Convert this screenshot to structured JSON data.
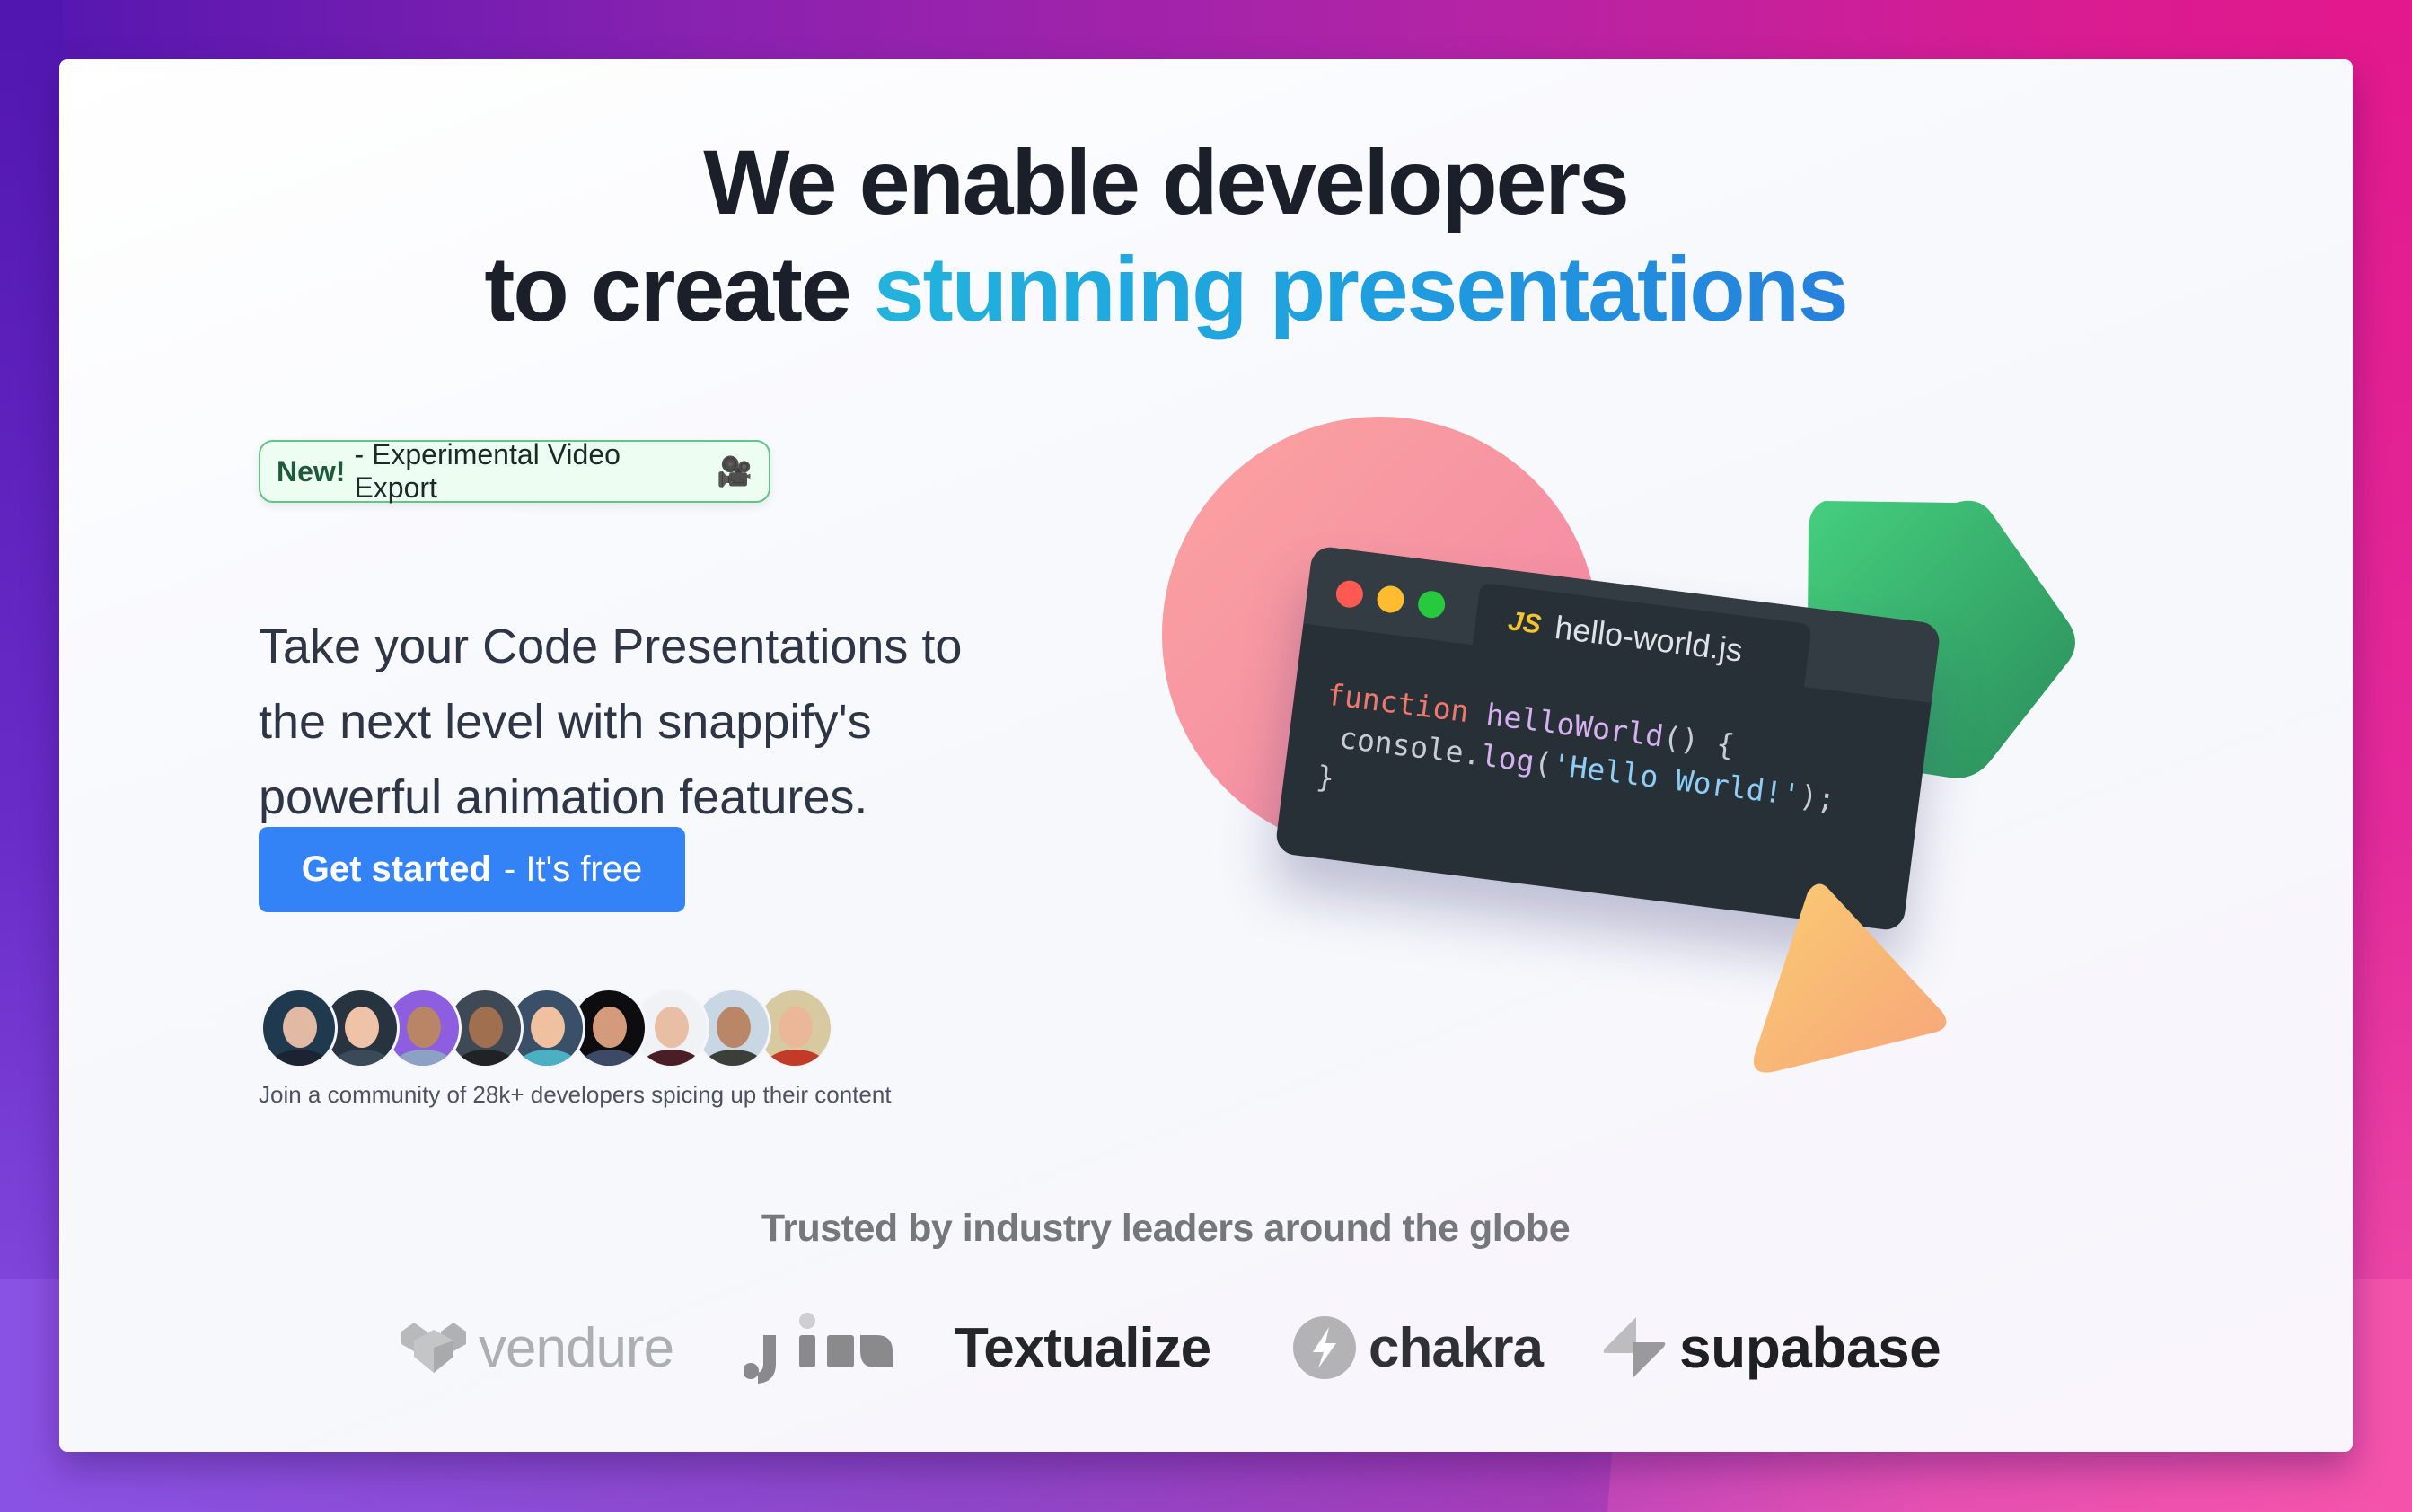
{
  "hero": {
    "headline_line1": "We enable developers",
    "headline_line2_prefix": "to create",
    "headline_line2_accent": "stunning presentations"
  },
  "badge": {
    "new_label": "New!",
    "text": "- Experimental Video Export",
    "icon": "movie-camera-icon",
    "icon_glyph": "🎥"
  },
  "lead": "Take your Code Presentations to the next level with snappify's powerful animation features.",
  "cta": {
    "primary": "Get started",
    "secondary": "- It's free"
  },
  "community": {
    "avatar_count": 9,
    "avatars": [
      {
        "bg": "#1f3a4e",
        "skin": "#e2b9a2",
        "shirt": "#1c2433"
      },
      {
        "bg": "#27343f",
        "skin": "#efc3a7",
        "shirt": "#3a4a58"
      },
      {
        "bg": "#8d5fe0",
        "skin": "#b88566",
        "shirt": "#8ca2c4"
      },
      {
        "bg": "#3e4955",
        "skin": "#9f6f50",
        "shirt": "#1f2326"
      },
      {
        "bg": "#3a4f68",
        "skin": "#f0c1a0",
        "shirt": "#4bb0c4"
      },
      {
        "bg": "#0d0d10",
        "skin": "#d39b7c",
        "shirt": "#3c4a66"
      },
      {
        "bg": "#f1f2f5",
        "skin": "#e8bfa4",
        "shirt": "#4a1e26"
      },
      {
        "bg": "#c9d7e4",
        "skin": "#b98668",
        "shirt": "#3b3f3a"
      },
      {
        "bg": "#d7c9a0",
        "skin": "#eab898",
        "shirt": "#c23b28"
      }
    ],
    "caption": "Join a community of 28k+ developers spicing up their content"
  },
  "illustration": {
    "filename": "hello-world.js",
    "lang_badge": "JS",
    "code_lines": [
      [
        {
          "t": "function ",
          "c": "kw"
        },
        {
          "t": "helloWorld",
          "c": "fn"
        },
        {
          "t": "() {",
          "c": "pl"
        }
      ],
      [
        {
          "t": " console.",
          "c": "pl"
        },
        {
          "t": "log",
          "c": "fn"
        },
        {
          "t": "(",
          "c": "pl"
        },
        {
          "t": "'Hello World!'",
          "c": "str"
        },
        {
          "t": ");",
          "c": "pl"
        }
      ],
      [
        {
          "t": "}",
          "c": "pl"
        }
      ]
    ],
    "colors": {
      "circle": [
        "#fba3a0",
        "#f285a5"
      ],
      "pentagon": [
        "#45cf7e",
        "#2a8c5a"
      ],
      "triangle": [
        "#f9cb72",
        "#f8a57a"
      ]
    }
  },
  "trusted": {
    "heading": "Trusted by industry leaders around the globe",
    "logos": [
      {
        "name": "vendure",
        "label": "vendure"
      },
      {
        "name": "jina",
        "label": "jina"
      },
      {
        "name": "textualize",
        "label": "Textualize"
      },
      {
        "name": "chakra",
        "label": "chakra"
      },
      {
        "name": "supabase",
        "label": "supabase"
      }
    ]
  },
  "colors": {
    "primary_button": "#3483f6",
    "headline": "#1b1f2a",
    "accent_gradient": [
      "#23b3dc",
      "#2680dc"
    ],
    "badge_border": "#62c487",
    "badge_bg": "#edfdf2"
  }
}
